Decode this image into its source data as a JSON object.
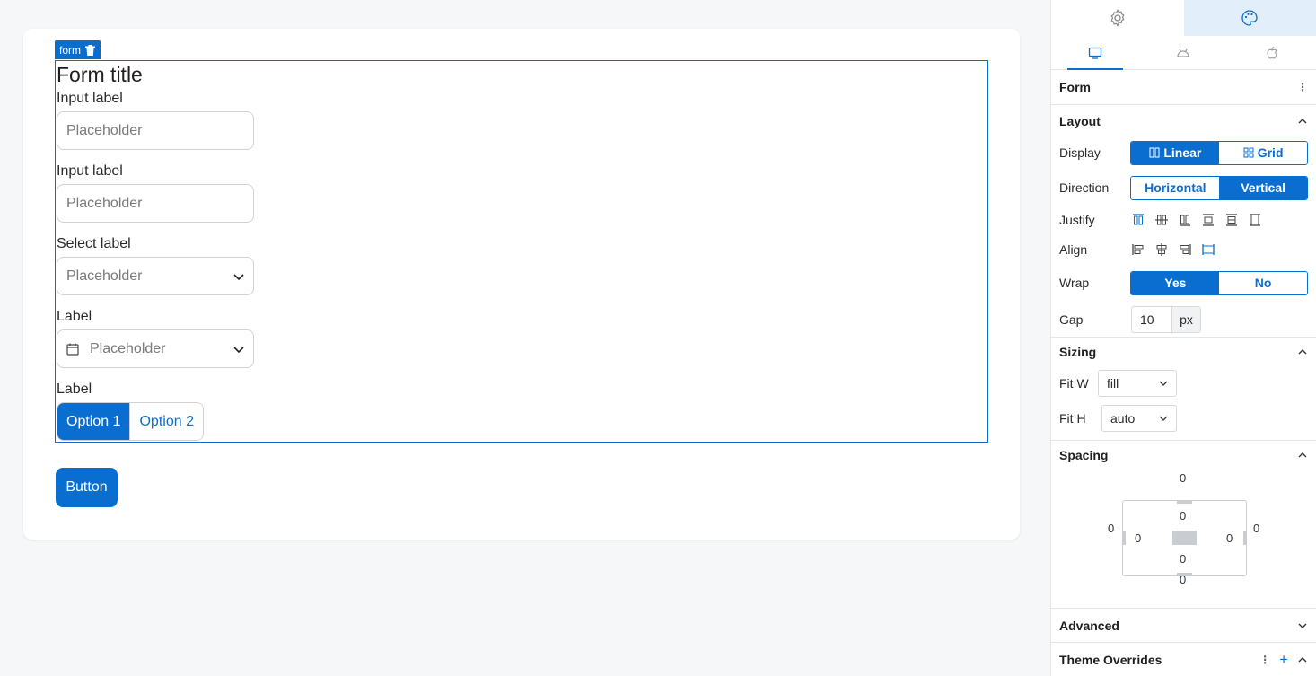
{
  "canvas": {
    "form_tag": "form",
    "form_title": "Form title",
    "fields": [
      {
        "label": "Input label",
        "placeholder": "Placeholder"
      },
      {
        "label": "Input label",
        "placeholder": "Placeholder"
      },
      {
        "label": "Select label",
        "placeholder": "Placeholder"
      },
      {
        "label": "Label",
        "placeholder": "Placeholder"
      }
    ],
    "segment": {
      "label": "Label",
      "options": [
        "Option 1",
        "Option 2"
      ],
      "selected": "Option 1"
    },
    "button": "Button"
  },
  "panel": {
    "tabs": [
      "settings-icon",
      "palette-icon"
    ],
    "device_tabs": [
      "desktop-icon",
      "android-icon",
      "apple-icon"
    ],
    "component": "Form",
    "layout": {
      "title": "Layout",
      "display_label": "Display",
      "display_options": [
        "Linear",
        "Grid"
      ],
      "direction_label": "Direction",
      "direction_options": [
        "Horizontal",
        "Vertical"
      ],
      "justify_label": "Justify",
      "align_label": "Align",
      "wrap_label": "Wrap",
      "wrap_options": [
        "Yes",
        "No"
      ],
      "gap_label": "Gap",
      "gap_value": "10",
      "gap_unit": "px"
    },
    "sizing": {
      "title": "Sizing",
      "fitw_label": "Fit W",
      "fitw_value": "fill",
      "fith_label": "Fit H",
      "fith_value": "auto"
    },
    "spacing": {
      "title": "Spacing",
      "margin_top": "0",
      "margin_right": "0",
      "margin_bottom": "0",
      "margin_left": "0",
      "padding_top": "0",
      "padding_right": "0",
      "padding_bottom": "0",
      "padding_left": "0"
    },
    "advanced": "Advanced",
    "theme_overrides": "Theme Overrides"
  },
  "colors": {
    "accent": "#0a6ed1"
  }
}
